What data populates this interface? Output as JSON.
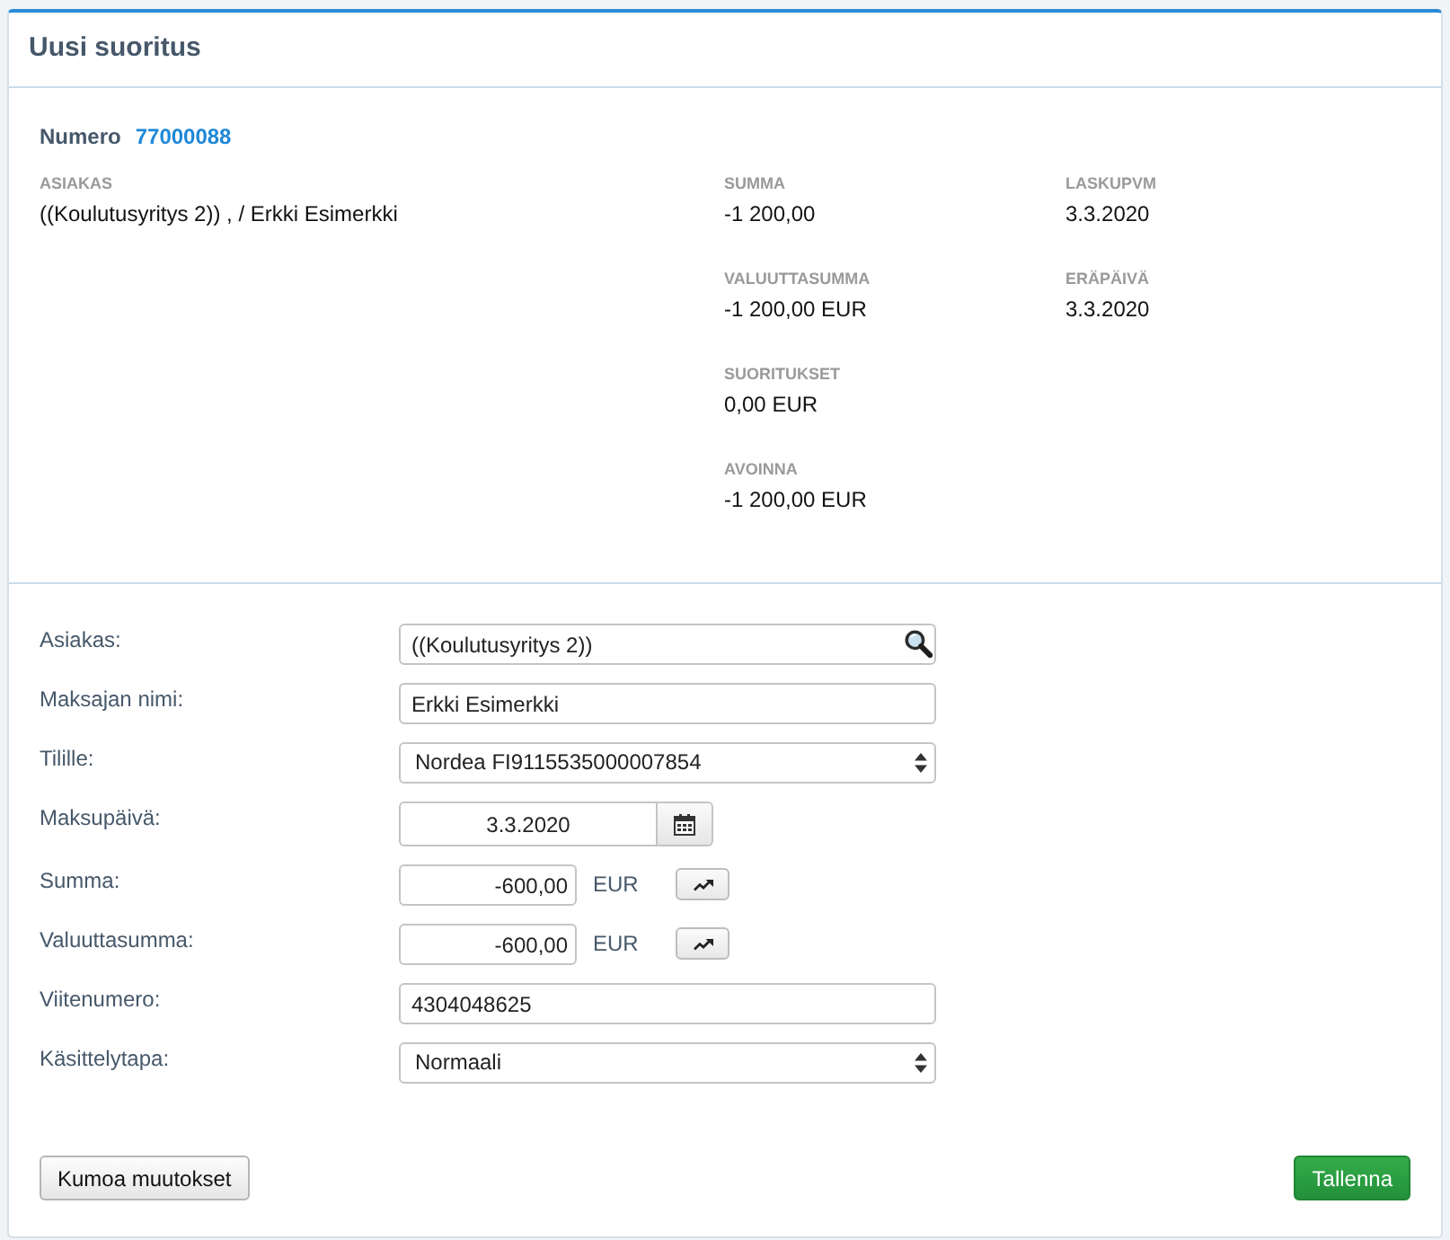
{
  "panel": {
    "title": "Uusi suoritus"
  },
  "summary": {
    "number_label": "Numero",
    "number": "77000088",
    "columns": [
      {
        "items": [
          {
            "label": "ASIAKAS",
            "value": "((Koulutusyritys 2)) , / Erkki Esimerkki"
          }
        ]
      },
      {
        "items": [
          {
            "label": "SUMMA",
            "value": "-1 200,00"
          },
          {
            "label": "VALUUTTASUMMA",
            "value": "-1 200,00 EUR"
          },
          {
            "label": "SUORITUKSET",
            "value": "0,00 EUR"
          },
          {
            "label": "AVOINNA",
            "value": "-1 200,00 EUR"
          }
        ]
      },
      {
        "items": [
          {
            "label": "LASKUPVM",
            "value": "3.3.2020"
          },
          {
            "label": "ERÄPÄIVÄ",
            "value": "3.3.2020"
          }
        ]
      }
    ]
  },
  "form": {
    "fields": [
      {
        "label": "Asiakas:",
        "kind": "lookup",
        "value": "((Koulutusyritys 2))"
      },
      {
        "label": "Maksajan nimi:",
        "kind": "text",
        "value": "Erkki Esimerkki"
      },
      {
        "label": "Tilille:",
        "kind": "select",
        "value": "Nordea FI9115535000007854"
      },
      {
        "label": "Maksupäivä:",
        "kind": "date",
        "value": "3.3.2020"
      },
      {
        "label": "Summa:",
        "kind": "amount",
        "value": "-600,00",
        "currency": "EUR"
      },
      {
        "label": "Valuuttasumma:",
        "kind": "amount",
        "value": "-600,00",
        "currency": "EUR"
      },
      {
        "label": "Viitenumero:",
        "kind": "text",
        "value": "4304048625"
      },
      {
        "label": "Käsittelytapa:",
        "kind": "select",
        "value": "Normaali"
      }
    ]
  },
  "buttons": [
    {
      "label": "Kumoa muutokset",
      "kind": "default"
    },
    {
      "label": "Tallenna",
      "kind": "success"
    }
  ]
}
